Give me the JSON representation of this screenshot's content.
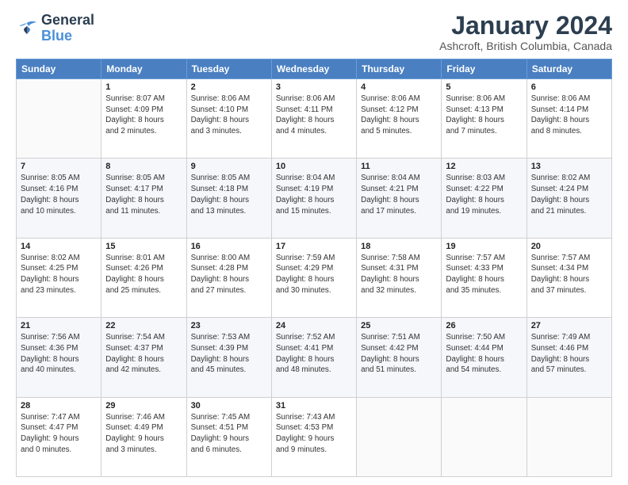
{
  "header": {
    "logo_line1": "General",
    "logo_line2": "Blue",
    "month_title": "January 2024",
    "location": "Ashcroft, British Columbia, Canada"
  },
  "weekdays": [
    "Sunday",
    "Monday",
    "Tuesday",
    "Wednesday",
    "Thursday",
    "Friday",
    "Saturday"
  ],
  "weeks": [
    [
      {
        "day": "",
        "info": ""
      },
      {
        "day": "1",
        "info": "Sunrise: 8:07 AM\nSunset: 4:09 PM\nDaylight: 8 hours\nand 2 minutes."
      },
      {
        "day": "2",
        "info": "Sunrise: 8:06 AM\nSunset: 4:10 PM\nDaylight: 8 hours\nand 3 minutes."
      },
      {
        "day": "3",
        "info": "Sunrise: 8:06 AM\nSunset: 4:11 PM\nDaylight: 8 hours\nand 4 minutes."
      },
      {
        "day": "4",
        "info": "Sunrise: 8:06 AM\nSunset: 4:12 PM\nDaylight: 8 hours\nand 5 minutes."
      },
      {
        "day": "5",
        "info": "Sunrise: 8:06 AM\nSunset: 4:13 PM\nDaylight: 8 hours\nand 7 minutes."
      },
      {
        "day": "6",
        "info": "Sunrise: 8:06 AM\nSunset: 4:14 PM\nDaylight: 8 hours\nand 8 minutes."
      }
    ],
    [
      {
        "day": "7",
        "info": "Sunrise: 8:05 AM\nSunset: 4:16 PM\nDaylight: 8 hours\nand 10 minutes."
      },
      {
        "day": "8",
        "info": "Sunrise: 8:05 AM\nSunset: 4:17 PM\nDaylight: 8 hours\nand 11 minutes."
      },
      {
        "day": "9",
        "info": "Sunrise: 8:05 AM\nSunset: 4:18 PM\nDaylight: 8 hours\nand 13 minutes."
      },
      {
        "day": "10",
        "info": "Sunrise: 8:04 AM\nSunset: 4:19 PM\nDaylight: 8 hours\nand 15 minutes."
      },
      {
        "day": "11",
        "info": "Sunrise: 8:04 AM\nSunset: 4:21 PM\nDaylight: 8 hours\nand 17 minutes."
      },
      {
        "day": "12",
        "info": "Sunrise: 8:03 AM\nSunset: 4:22 PM\nDaylight: 8 hours\nand 19 minutes."
      },
      {
        "day": "13",
        "info": "Sunrise: 8:02 AM\nSunset: 4:24 PM\nDaylight: 8 hours\nand 21 minutes."
      }
    ],
    [
      {
        "day": "14",
        "info": "Sunrise: 8:02 AM\nSunset: 4:25 PM\nDaylight: 8 hours\nand 23 minutes."
      },
      {
        "day": "15",
        "info": "Sunrise: 8:01 AM\nSunset: 4:26 PM\nDaylight: 8 hours\nand 25 minutes."
      },
      {
        "day": "16",
        "info": "Sunrise: 8:00 AM\nSunset: 4:28 PM\nDaylight: 8 hours\nand 27 minutes."
      },
      {
        "day": "17",
        "info": "Sunrise: 7:59 AM\nSunset: 4:29 PM\nDaylight: 8 hours\nand 30 minutes."
      },
      {
        "day": "18",
        "info": "Sunrise: 7:58 AM\nSunset: 4:31 PM\nDaylight: 8 hours\nand 32 minutes."
      },
      {
        "day": "19",
        "info": "Sunrise: 7:57 AM\nSunset: 4:33 PM\nDaylight: 8 hours\nand 35 minutes."
      },
      {
        "day": "20",
        "info": "Sunrise: 7:57 AM\nSunset: 4:34 PM\nDaylight: 8 hours\nand 37 minutes."
      }
    ],
    [
      {
        "day": "21",
        "info": "Sunrise: 7:56 AM\nSunset: 4:36 PM\nDaylight: 8 hours\nand 40 minutes."
      },
      {
        "day": "22",
        "info": "Sunrise: 7:54 AM\nSunset: 4:37 PM\nDaylight: 8 hours\nand 42 minutes."
      },
      {
        "day": "23",
        "info": "Sunrise: 7:53 AM\nSunset: 4:39 PM\nDaylight: 8 hours\nand 45 minutes."
      },
      {
        "day": "24",
        "info": "Sunrise: 7:52 AM\nSunset: 4:41 PM\nDaylight: 8 hours\nand 48 minutes."
      },
      {
        "day": "25",
        "info": "Sunrise: 7:51 AM\nSunset: 4:42 PM\nDaylight: 8 hours\nand 51 minutes."
      },
      {
        "day": "26",
        "info": "Sunrise: 7:50 AM\nSunset: 4:44 PM\nDaylight: 8 hours\nand 54 minutes."
      },
      {
        "day": "27",
        "info": "Sunrise: 7:49 AM\nSunset: 4:46 PM\nDaylight: 8 hours\nand 57 minutes."
      }
    ],
    [
      {
        "day": "28",
        "info": "Sunrise: 7:47 AM\nSunset: 4:47 PM\nDaylight: 9 hours\nand 0 minutes."
      },
      {
        "day": "29",
        "info": "Sunrise: 7:46 AM\nSunset: 4:49 PM\nDaylight: 9 hours\nand 3 minutes."
      },
      {
        "day": "30",
        "info": "Sunrise: 7:45 AM\nSunset: 4:51 PM\nDaylight: 9 hours\nand 6 minutes."
      },
      {
        "day": "31",
        "info": "Sunrise: 7:43 AM\nSunset: 4:53 PM\nDaylight: 9 hours\nand 9 minutes."
      },
      {
        "day": "",
        "info": ""
      },
      {
        "day": "",
        "info": ""
      },
      {
        "day": "",
        "info": ""
      }
    ]
  ]
}
